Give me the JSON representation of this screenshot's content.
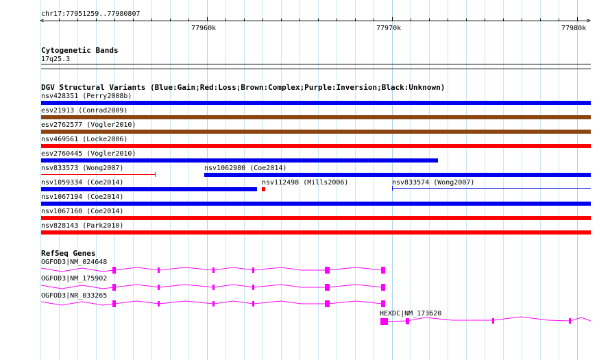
{
  "ruler": {
    "location": "chr17:77951259..77980807",
    "ticks": [
      {
        "label": "77960k"
      },
      {
        "label": "77970k"
      },
      {
        "label": "77980k"
      }
    ]
  },
  "cytobands": {
    "title": "Cytogenetic Bands",
    "band": "17q25.3"
  },
  "dgv": {
    "title": "DGV Structural Variants (Blue:Gain;Red:Loss;Brown:Complex;Purple:Inversion;Black:Unknown)",
    "colors": {
      "gain": "#0000ee",
      "loss": "#ff0000",
      "complex": "#8b4513",
      "unknown": "#000000"
    },
    "variants": [
      {
        "id": "nsv428351",
        "label": "nsv428351 (Perry2008b)",
        "type": "gain"
      },
      {
        "id": "esv21913",
        "label": "esv21913 (Conrad2009)",
        "type": "complex"
      },
      {
        "id": "esv2762577",
        "label": "esv2762577 (Vogler2010)",
        "type": "complex"
      },
      {
        "id": "nsv469561",
        "label": "nsv469561 (Locke2006)",
        "type": "loss"
      },
      {
        "id": "esv2760445",
        "label": "esv2760445 (Vogler2010)",
        "type": "gain"
      },
      {
        "id": "nsv833573",
        "label": "nsv833573 (Wong2007)",
        "type": "loss"
      },
      {
        "id": "nsv1062980",
        "label": "nsv1062980 (Coe2014)",
        "type": "gain"
      },
      {
        "id": "nsv1059334",
        "label": "nsv1059334 (Coe2014)",
        "type": "gain"
      },
      {
        "id": "nsv112498",
        "label": "nsv112498 (Mills2006)",
        "type": "loss"
      },
      {
        "id": "nsv833574",
        "label": "nsv833574 (Wong2007)",
        "type": "gain"
      },
      {
        "id": "nsv1067194",
        "label": "nsv1067194 (Coe2014)",
        "type": "gain"
      },
      {
        "id": "nsv1067160",
        "label": "nsv1067160 (Coe2014)",
        "type": "loss"
      },
      {
        "id": "nsv828143",
        "label": "nsv828143 (Park2010)",
        "type": "loss"
      }
    ]
  },
  "refseq": {
    "title": "RefSeq Genes",
    "color": "#ff00ff",
    "genes": [
      {
        "label": "OGFOD3|NM_024648"
      },
      {
        "label": "OGFOD3|NM_175902"
      },
      {
        "label": "OGFOD3|NR_033265"
      },
      {
        "label": "HEXDC|NM_173620"
      }
    ]
  }
}
